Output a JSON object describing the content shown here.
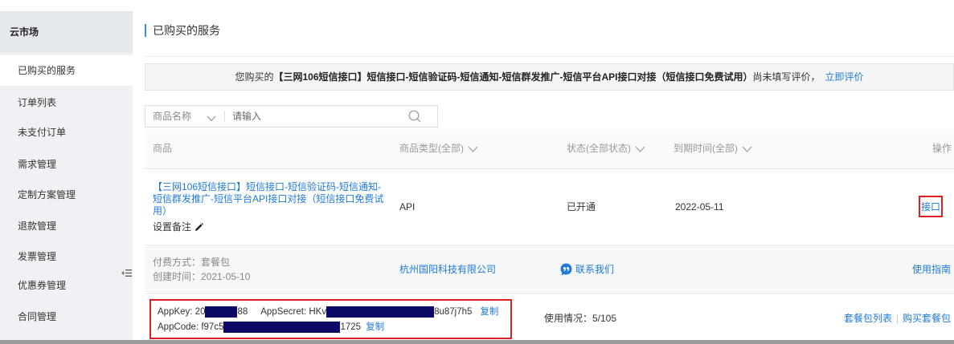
{
  "sidebar": {
    "header": "云市场",
    "items": [
      {
        "label": "已购买的服务",
        "active": true
      },
      {
        "label": "订单列表"
      },
      {
        "label": "未支付订单"
      },
      {
        "label": "需求管理"
      },
      {
        "label": "定制方案管理"
      },
      {
        "label": "退款管理"
      },
      {
        "label": "发票管理"
      },
      {
        "label": "优惠券管理"
      },
      {
        "label": "合同管理"
      }
    ]
  },
  "page": {
    "title": "已购买的服务"
  },
  "notice": {
    "prefix": "您购买的",
    "product": "【三网106短信接口】短信接口-短信验证码-短信通知-短信群发推广-短信平台API接口对接（短信接口免费试用）",
    "suffix": "尚未填写评价，",
    "link": "立即评价"
  },
  "search": {
    "field": "商品名称",
    "placeholder": "请输入"
  },
  "table": {
    "headers": {
      "product": "商品",
      "type": "商品类型(全部)",
      "status": "状态(全部状态)",
      "expiry": "到期时间(全部)",
      "action": "操作"
    }
  },
  "order": {
    "product_name": "【三网106短信接口】短信接口-短信验证码-短信通知-短信群发推广-短信平台API接口对接（短信接口免费试用）",
    "note_label": "设置备注",
    "type": "API",
    "status": "已开通",
    "expiry": "2022-05-11",
    "action": "接口",
    "payment": "付费方式：套餐包",
    "created": "创建时间：2021-05-10",
    "vendor": "杭州国阳科技有限公司",
    "contact": "联系我们",
    "guide": "使用指南",
    "credentials": {
      "appkey_prefix": "AppKey: 20",
      "appkey_suffix": "88",
      "appsecret_prefix": "AppSecret: HKv",
      "appsecret_suffix": "8u87j7h5",
      "appcode_prefix": "AppCode: f97c5",
      "appcode_suffix": "1725",
      "copy_label": "复制"
    },
    "usage": "使用情况：5/105",
    "package_list": "套餐包列表",
    "buy_package": "购买套餐包"
  },
  "icons": {
    "sidebar_toggle": "collapse-sidebar-icon",
    "dropdown": "chevron-down-icon",
    "search": "search-icon",
    "edit_note": "pencil-icon",
    "contact": "chat-icon"
  },
  "colors": {
    "link": "#1f7ad6",
    "highlight_box": "#e02020",
    "redaction": "#0b0a66",
    "sidebar_bg": "#eff1f4",
    "accent_bar": "#3d8fe0"
  }
}
